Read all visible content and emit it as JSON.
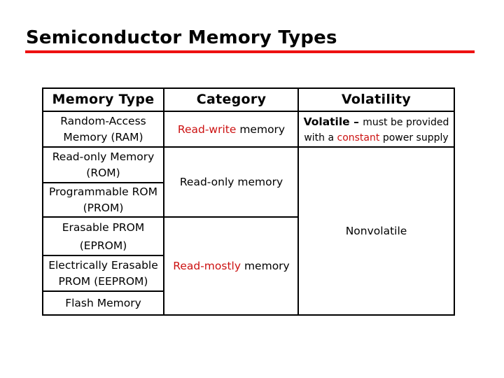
{
  "slide": {
    "title": "Semiconductor Memory Types",
    "accent_color": "#ee1111",
    "highlight_color": "#cc1111"
  },
  "table": {
    "headers": {
      "type": "Memory Type",
      "category": "Category",
      "volatility": "Volatility"
    },
    "memory_types": [
      {
        "line1": "Random-Access",
        "line2": "Memory (RAM)"
      },
      {
        "line1": "Read-only Memory",
        "line2": "(ROM)"
      },
      {
        "line1": "Programmable ROM",
        "line2": "(PROM)"
      },
      {
        "line1": "Erasable PROM",
        "line2": "(EPROM)"
      },
      {
        "line1": "Electrically Erasable",
        "line2": "PROM (EEPROM)"
      },
      {
        "line1": "Flash Memory",
        "line2": ""
      }
    ],
    "categories": [
      {
        "highlight": "Read-write",
        "rest": " memory",
        "applies_to": "RAM"
      },
      {
        "highlight": "",
        "rest": "Read-only memory",
        "applies_to": "ROM, PROM"
      },
      {
        "highlight": "Read-mostly",
        "rest": " memory",
        "applies_to": "EPROM, EEPROM, Flash Memory"
      }
    ],
    "volatility": [
      {
        "bold": "Volatile",
        "dash": " – ",
        "text1": "must be provided",
        "text2_pre": "with a ",
        "text2_highlight": "constant",
        "text2_post": " power supply",
        "applies_to": "RAM"
      },
      {
        "text": "Nonvolatile",
        "applies_to": "ROM, PROM, EPROM, EEPROM, Flash Memory"
      }
    ]
  }
}
